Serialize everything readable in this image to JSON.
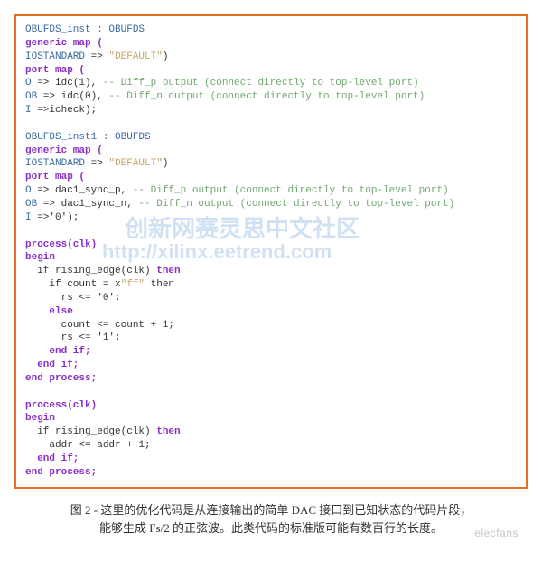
{
  "code": {
    "inst1_decl": "OBUFDS_inst : OBUFDS",
    "generic_map": "generic map (",
    "iostandard_kw": "IOSTANDARD",
    "arrow": " => ",
    "default_str": "\"DEFAULT\"",
    "close_paren": ")",
    "port_map": "port map (",
    "o_kw": "O",
    "o1_rhs": " => idc(1), ",
    "o1_cmt": "-- Diff_p output (connect directly to top-level port)",
    "ob_kw": "OB",
    "ob1_rhs": " => idc(0), ",
    "ob1_cmt": "-- Diff_n output (connect directly to top-level port)",
    "i_kw": "I",
    "i1_rhs": " =>icheck);",
    "inst2_decl": "OBUFDS_inst1 : OBUFDS",
    "o2_rhs": " => dac1_sync_p, ",
    "o2_cmt": "-- Diff_p output (connect directly to top-level port)",
    "ob2_rhs": " => dac1_sync_n, ",
    "ob2_cmt": "-- Diff_n output (connect directly to top-level port)",
    "i2_rhs": " =>'0');",
    "process_hdr": "process(clk)",
    "begin": "begin",
    "if_rising": "  if rising_edge(clk) ",
    "then": "then",
    "if_count": "    if count = x",
    "ff_str": "\"ff\"",
    "then_tail": " then",
    "rs0": "      rs <= '0';",
    "else": "    else",
    "count_inc": "      count <= count + 1;",
    "rs1": "      rs <= '1';",
    "endif1": "    end if;",
    "endif2": "  end if;",
    "end_process": "end process;",
    "addr_inc": "    addr <= addr + 1;"
  },
  "watermark": {
    "line1": "创新网赛灵思中文社区",
    "line2": "http://xilinx.eetrend.com",
    "corner": "elecfans"
  },
  "caption": {
    "line1": "图 2 - 这里的优化代码是从连接输出的简单 DAC 接口到已知状态的代码片段，",
    "line2": "能够生成 Fs/2 的正弦波。此类代码的标准版可能有数百行的长度。"
  }
}
